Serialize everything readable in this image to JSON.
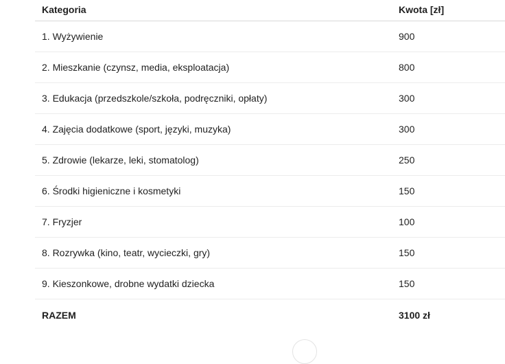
{
  "table": {
    "headers": {
      "category": "Kategoria",
      "amount": "Kwota [zł]"
    },
    "rows": [
      {
        "category": "1. Wyżywienie",
        "amount": "900"
      },
      {
        "category": "2. Mieszkanie (czynsz, media, eksploatacja)",
        "amount": "800"
      },
      {
        "category": "3. Edukacja (przedszkole/szkoła, podręczniki, opłaty)",
        "amount": "300"
      },
      {
        "category": "4. Zajęcia dodatkowe (sport, języki, muzyka)",
        "amount": "300"
      },
      {
        "category": "5. Zdrowie (lekarze, leki, stomatolog)",
        "amount": "250"
      },
      {
        "category": "6. Środki higieniczne i kosmetyki",
        "amount": "150"
      },
      {
        "category": "7. Fryzjer",
        "amount": "100"
      },
      {
        "category": "8. Rozrywka (kino, teatr, wycieczki, gry)",
        "amount": "150"
      },
      {
        "category": "9. Kieszonkowe, drobne wydatki dziecka",
        "amount": "150"
      }
    ],
    "total": {
      "category": "RAZEM",
      "amount": "3100 zł"
    }
  }
}
